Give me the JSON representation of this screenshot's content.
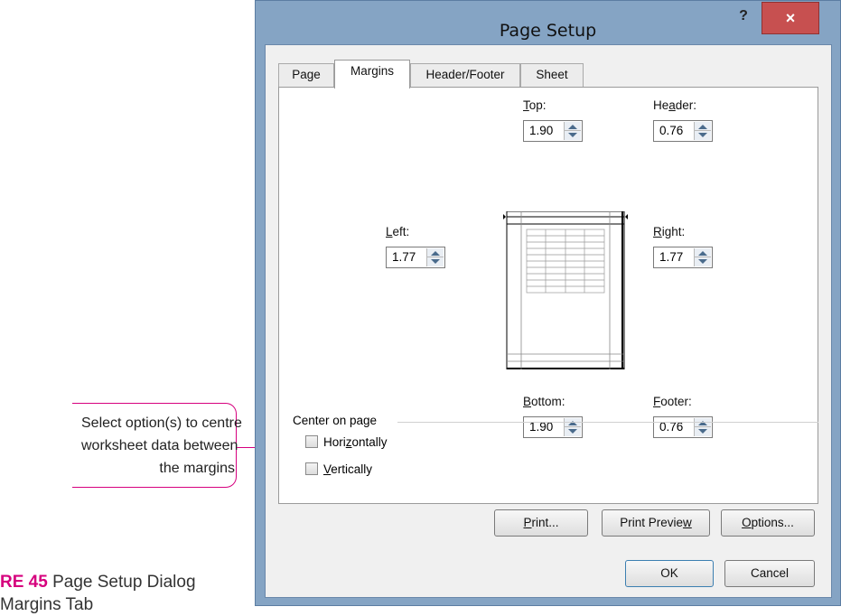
{
  "dialog": {
    "title": "Page Setup",
    "help_label": "?",
    "close_label": "×",
    "tabs": [
      {
        "label": "Page",
        "active": false
      },
      {
        "label": "Margins",
        "active": true
      },
      {
        "label": "Header/Footer",
        "active": false
      },
      {
        "label": "Sheet",
        "active": false
      }
    ],
    "margins": {
      "top": {
        "label_pre": "",
        "label_u": "T",
        "label_post": "op:",
        "value": "1.90"
      },
      "header": {
        "label_pre": "He",
        "label_u": "a",
        "label_post": "der:",
        "value": "0.76"
      },
      "left": {
        "label_pre": "",
        "label_u": "L",
        "label_post": "eft:",
        "value": "1.77"
      },
      "right": {
        "label_pre": "",
        "label_u": "R",
        "label_post": "ight:",
        "value": "1.77"
      },
      "bottom": {
        "label_pre": "",
        "label_u": "B",
        "label_post": "ottom:",
        "value": "1.90"
      },
      "footer": {
        "label_pre": "",
        "label_u": "F",
        "label_post": "ooter:",
        "value": "0.76"
      }
    },
    "center_on_page": {
      "label": "Center on page",
      "horizontally": {
        "pre": "Hori",
        "u": "z",
        "post": "ontally",
        "checked": false
      },
      "vertically": {
        "pre": "",
        "u": "V",
        "post": "ertically",
        "checked": false
      }
    },
    "buttons": {
      "print": {
        "pre": "",
        "u": "P",
        "post": "rint..."
      },
      "print_preview": {
        "pre": "Print Previe",
        "u": "w",
        "post": ""
      },
      "options": {
        "pre": "",
        "u": "O",
        "post": "ptions..."
      },
      "ok": "OK",
      "cancel": "Cancel"
    }
  },
  "callout": {
    "lines": [
      "Select option(s) to centre",
      "worksheet data between",
      "the margins"
    ]
  },
  "caption": {
    "figure": "RE 45",
    "text1": " Page Setup Dialog",
    "text2": "Margins Tab"
  },
  "colors": {
    "accent": "#d6007e",
    "frame": "#85a4c4",
    "close": "#c75050"
  }
}
